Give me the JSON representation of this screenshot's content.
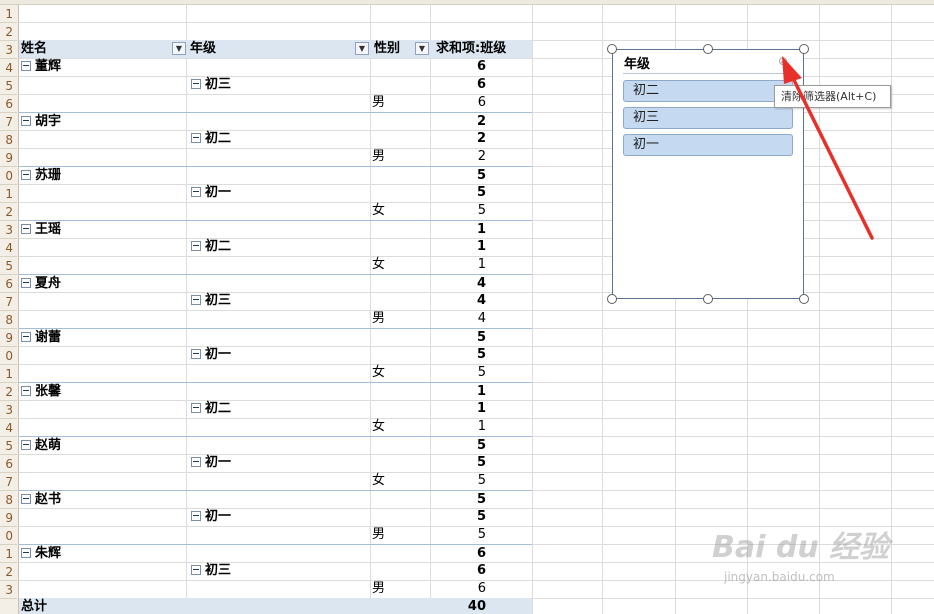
{
  "row_numbers": [
    "1",
    "2",
    "3",
    "4",
    "5",
    "6",
    "7",
    "8",
    "9",
    "0",
    "1",
    "2",
    "3",
    "4",
    "5",
    "6",
    "7",
    "8",
    "9",
    "0",
    "1",
    "2",
    "3",
    "4",
    "5",
    "6",
    "7",
    "8",
    "9",
    "0",
    "1",
    "2",
    "3"
  ],
  "pivot": {
    "headers": {
      "name": "姓名",
      "grade": "年级",
      "sex": "性别",
      "sum": "求和项:班级"
    },
    "rows": [
      {
        "type": "name",
        "name": "董辉",
        "val": "6"
      },
      {
        "type": "grade",
        "grade": "初三",
        "val": "6"
      },
      {
        "type": "sex",
        "sex": "男",
        "val": "6"
      },
      {
        "type": "name",
        "name": "胡宇",
        "val": "2"
      },
      {
        "type": "grade",
        "grade": "初二",
        "val": "2"
      },
      {
        "type": "sex",
        "sex": "男",
        "val": "2"
      },
      {
        "type": "name",
        "name": "苏珊",
        "val": "5"
      },
      {
        "type": "grade",
        "grade": "初一",
        "val": "5"
      },
      {
        "type": "sex",
        "sex": "女",
        "val": "5"
      },
      {
        "type": "name",
        "name": "王瑶",
        "val": "1"
      },
      {
        "type": "grade",
        "grade": "初二",
        "val": "1"
      },
      {
        "type": "sex",
        "sex": "女",
        "val": "1"
      },
      {
        "type": "name",
        "name": "夏舟",
        "val": "4"
      },
      {
        "type": "grade",
        "grade": "初三",
        "val": "4"
      },
      {
        "type": "sex",
        "sex": "男",
        "val": "4"
      },
      {
        "type": "name",
        "name": "谢蕾",
        "val": "5"
      },
      {
        "type": "grade",
        "grade": "初一",
        "val": "5"
      },
      {
        "type": "sex",
        "sex": "女",
        "val": "5"
      },
      {
        "type": "name",
        "name": "张馨",
        "val": "1"
      },
      {
        "type": "grade",
        "grade": "初二",
        "val": "1"
      },
      {
        "type": "sex",
        "sex": "女",
        "val": "1"
      },
      {
        "type": "name",
        "name": "赵萌",
        "val": "5"
      },
      {
        "type": "grade",
        "grade": "初一",
        "val": "5"
      },
      {
        "type": "sex",
        "sex": "女",
        "val": "5"
      },
      {
        "type": "name",
        "name": "赵书",
        "val": "5"
      },
      {
        "type": "grade",
        "grade": "初一",
        "val": "5"
      },
      {
        "type": "sex",
        "sex": "男",
        "val": "5"
      },
      {
        "type": "name",
        "name": "朱辉",
        "val": "6"
      },
      {
        "type": "grade",
        "grade": "初三",
        "val": "6"
      },
      {
        "type": "sex",
        "sex": "男",
        "val": "6"
      }
    ],
    "total": {
      "label": "总计",
      "val": "40"
    }
  },
  "slicer": {
    "title": "年级",
    "items": [
      "初二",
      "初三",
      "初一"
    ],
    "clear_icon": "clear-filter-icon"
  },
  "tooltip": {
    "text": "清除筛选器(Alt+C)"
  },
  "watermark": {
    "logo": "Bai du 经验",
    "url": "jingyan.baidu.com"
  },
  "colors": {
    "header_fill": "#dce6f1",
    "slicer_item": "#c5d9f1",
    "arrow": "#e8302a"
  }
}
